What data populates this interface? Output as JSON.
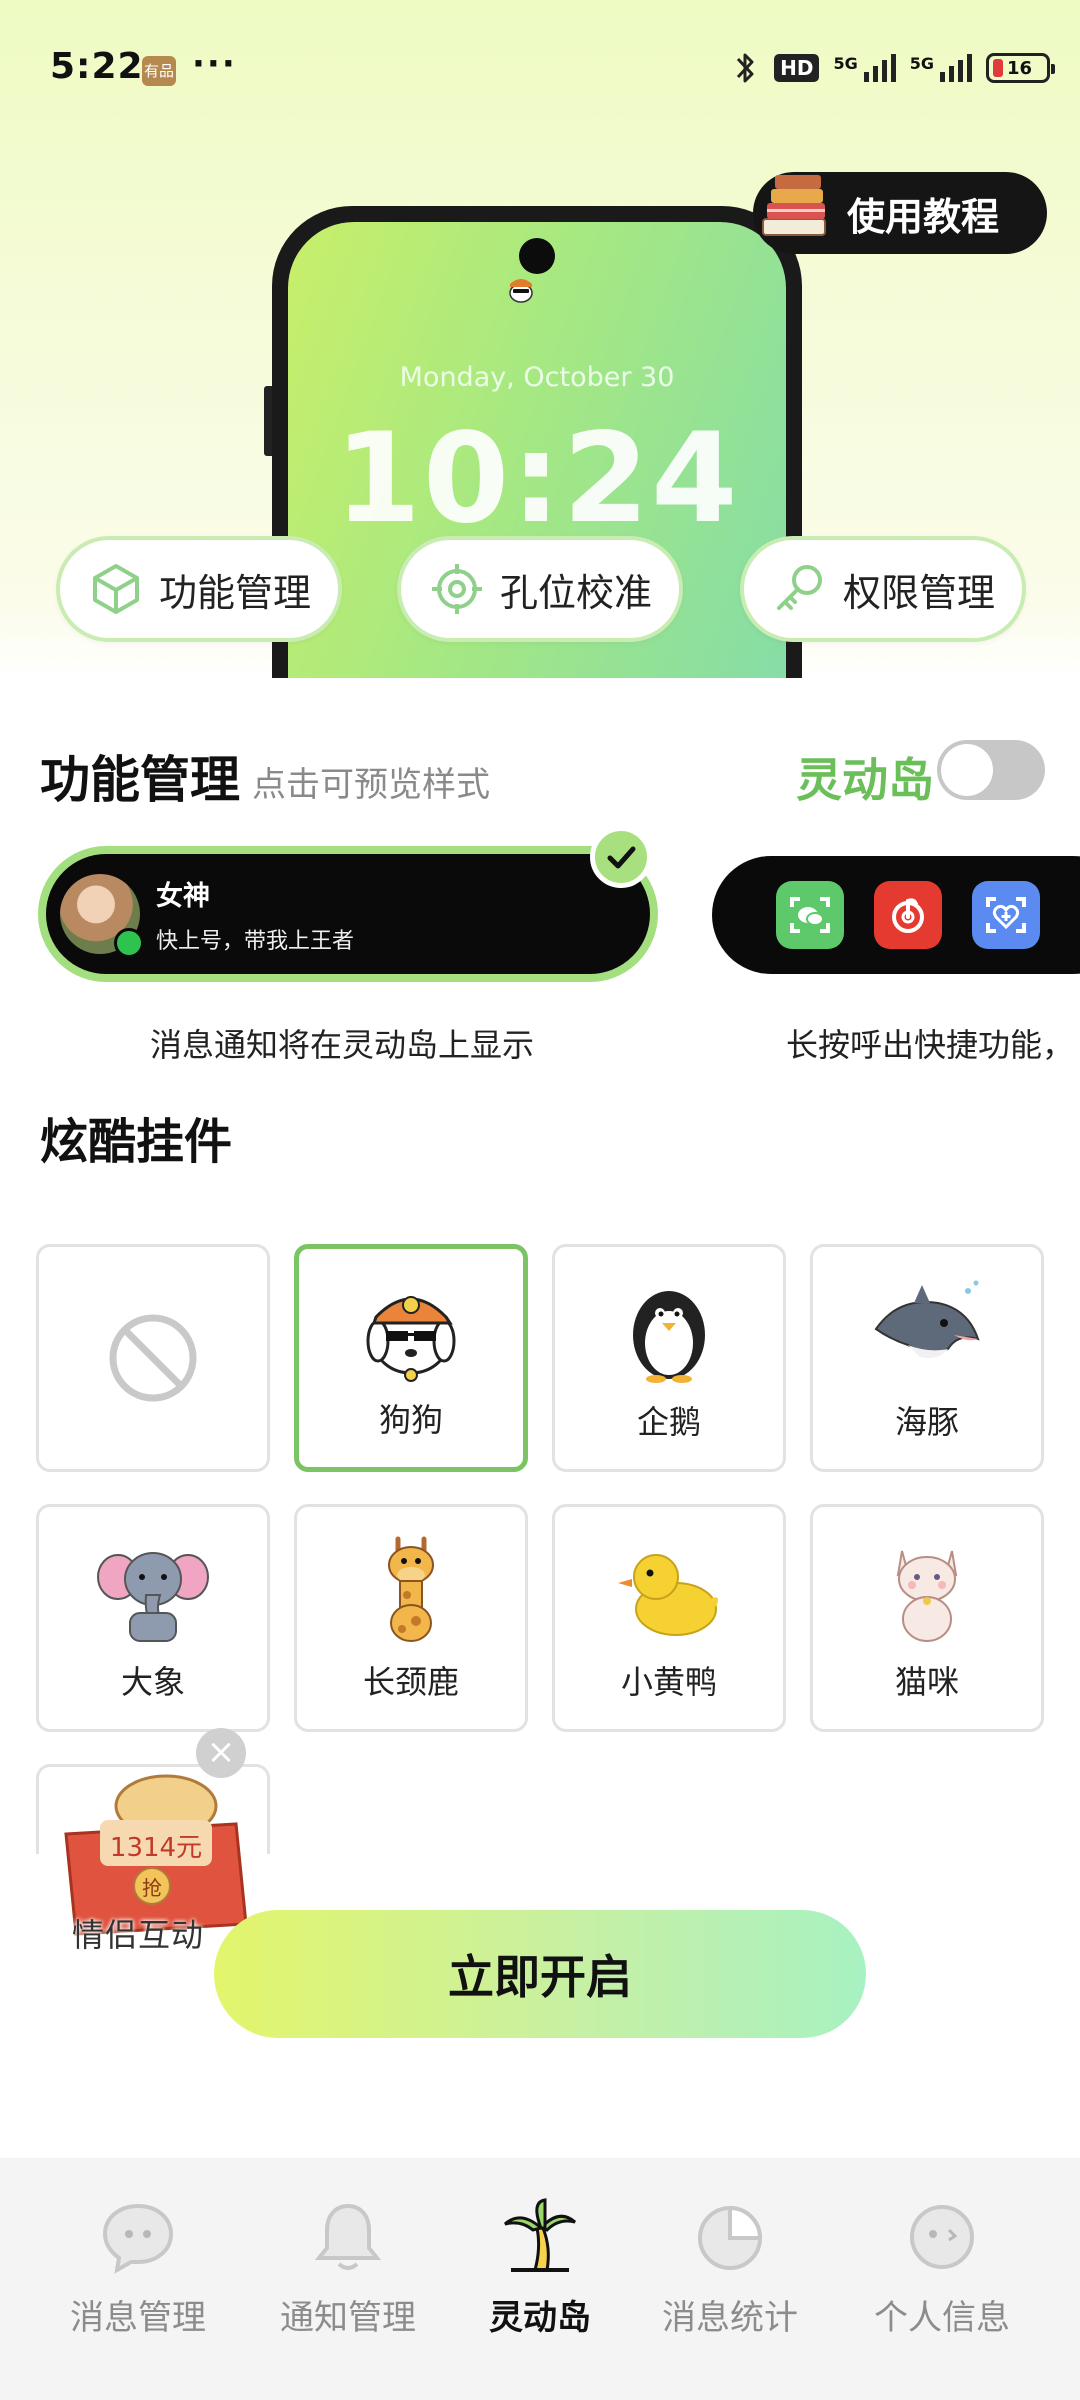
{
  "status_bar": {
    "time": "5:22",
    "badge": "有品",
    "dots": "···",
    "hd": "HD",
    "net1": "5G",
    "net2": "5G",
    "battery": "16"
  },
  "preview": {
    "date": "Monday, October 30",
    "time": "10:24"
  },
  "tutorial": {
    "label": "使用教程"
  },
  "pills": [
    {
      "label": "功能管理"
    },
    {
      "label": "孔位校准"
    },
    {
      "label": "权限管理"
    }
  ],
  "feature": {
    "title": "功能管理",
    "hint": "点击可预览样式",
    "island_label": "灵动岛",
    "island_toggle_on": false
  },
  "notification": {
    "name": "女神",
    "message": "快上号，带我上王者"
  },
  "captions": {
    "left": "消息通知将在灵动岛上显示",
    "right": "长按呼出快捷功能，"
  },
  "widgets": {
    "title": "炫酷挂件",
    "items": [
      {
        "label": "",
        "icon": "none-icon"
      },
      {
        "label": "狗狗",
        "icon": "dog-icon"
      },
      {
        "label": "企鹅",
        "icon": "penguin-icon"
      },
      {
        "label": "海豚",
        "icon": "dolphin-icon"
      },
      {
        "label": "大象",
        "icon": "elephant-icon"
      },
      {
        "label": "长颈鹿",
        "icon": "giraffe-icon"
      },
      {
        "label": "小黄鸭",
        "icon": "duck-icon"
      },
      {
        "label": "猫咪",
        "icon": "cat-icon"
      }
    ]
  },
  "couple": {
    "amount": "1314元",
    "grab": "抢",
    "label": "情侣互动"
  },
  "cta": {
    "label": "立即开启"
  },
  "tabs": [
    {
      "label": "消息管理",
      "icon": "chat-icon"
    },
    {
      "label": "通知管理",
      "icon": "bell-icon"
    },
    {
      "label": "灵动岛",
      "icon": "palm-island-icon"
    },
    {
      "label": "消息统计",
      "icon": "pie-chart-icon"
    },
    {
      "label": "个人信息",
      "icon": "face-icon"
    }
  ],
  "colors": {
    "accent_green": "#6bbf59",
    "selected_border": "#7bc463",
    "cta_start": "#e3f56b",
    "cta_end": "#a8f1c2"
  }
}
